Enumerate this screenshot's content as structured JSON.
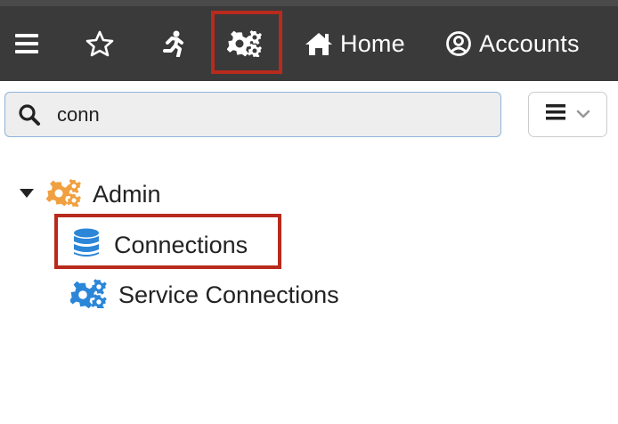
{
  "toolbar": {
    "items": [
      {
        "icon": "hamburger-menu-icon"
      },
      {
        "icon": "star-icon"
      },
      {
        "icon": "running-person-icon"
      },
      {
        "icon": "gears-icon",
        "highlighted": true
      },
      {
        "icon": "home-icon",
        "label": "Home"
      },
      {
        "icon": "user-circle-icon",
        "label": "Accounts"
      }
    ],
    "background": "#3a3a3a"
  },
  "search": {
    "value": "conn",
    "icon": "search-icon"
  },
  "view_menu": {
    "icons": [
      "list-icon",
      "chevron-down-icon"
    ]
  },
  "tree": {
    "group": {
      "label": "Admin",
      "icon": "gears-icon",
      "expanded": true,
      "icon_color": "#f0a040"
    },
    "items": [
      {
        "label": "Connections",
        "icon": "database-icon",
        "highlighted": true,
        "icon_color": "#2b86d8"
      },
      {
        "label": "Service Connections",
        "icon": "gears-icon",
        "icon_color": "#2b86d8"
      }
    ]
  },
  "colors": {
    "highlight_border": "#b82a1c",
    "search_border": "#8fb3d9"
  }
}
